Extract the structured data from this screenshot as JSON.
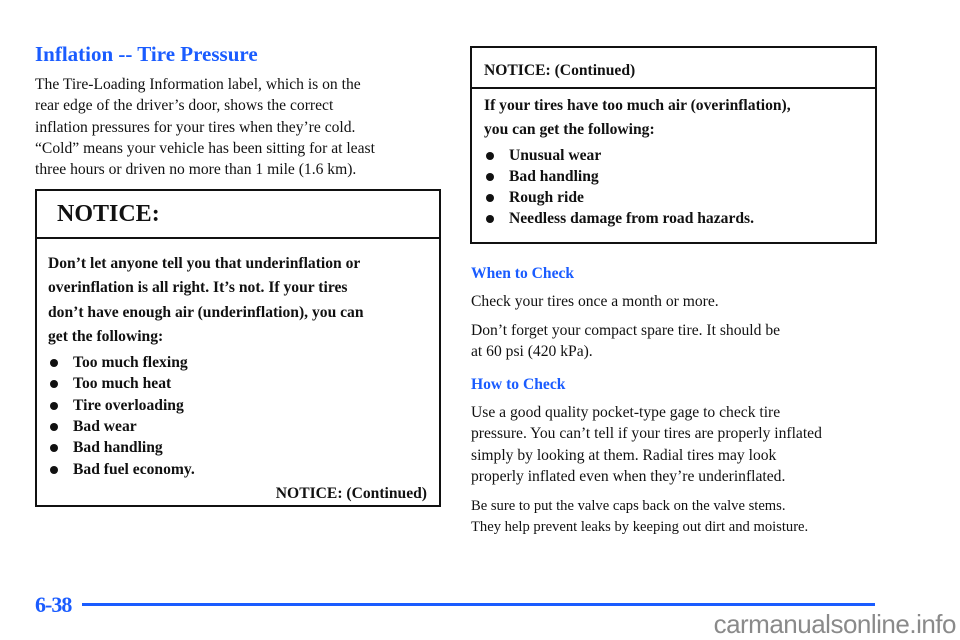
{
  "section_title": "Inflation -- Tire Pressure",
  "intro_lines": [
    "The Tire-Loading Information label, which is on the",
    "rear edge of the driver’s door, shows the correct",
    "inflation pressures for your tires when they’re cold.",
    "“Cold” means your vehicle has been sitting for at least",
    "three hours or driven no more than 1 mile (1.6 km)."
  ],
  "notice1": {
    "header": "NOTICE:",
    "body_lines": [
      "Don’t let anyone tell you that underinflation or",
      "overinflation is all right. It’s not. If your tires",
      "don’t have enough air (underinflation), you can",
      "get the following:"
    ],
    "bullets": [
      "Too much flexing",
      "Too much heat",
      "Tire overloading",
      "Bad wear",
      "Bad handling",
      "Bad fuel economy."
    ],
    "continued": "NOTICE: (Continued)"
  },
  "notice2": {
    "header": "NOTICE: (Continued)",
    "body_lines": [
      "If your tires have too much air (overinflation),",
      "you can get the following:"
    ],
    "bullets": [
      "Unusual wear",
      "Bad handling",
      "Rough ride",
      "Needless damage from road hazards."
    ]
  },
  "when_to_check": {
    "heading": "When to Check",
    "p1": "Check your tires once a month or more.",
    "p2_lines": [
      "Don’t forget your compact spare tire. It should be",
      "at 60 psi (420 kPa)."
    ]
  },
  "how_to_check": {
    "heading": "How to Check",
    "p1_lines": [
      "Use a good quality pocket-type gage to check tire",
      "pressure. You can’t tell if your tires are properly inflated",
      "simply by looking at them. Radial tires may look",
      "properly inflated even when they’re underinflated."
    ],
    "p2_lines": [
      "Be sure to put the valve caps back on the valve stems.",
      "They help prevent leaks by keeping out dirt and moisture."
    ]
  },
  "footer": {
    "page_number": "6-38",
    "watermark": "carmanualsonline.info"
  },
  "colors": {
    "heading_blue": "#1a5cff",
    "text": "#111111",
    "watermark_gray": "#8a8a8a"
  }
}
